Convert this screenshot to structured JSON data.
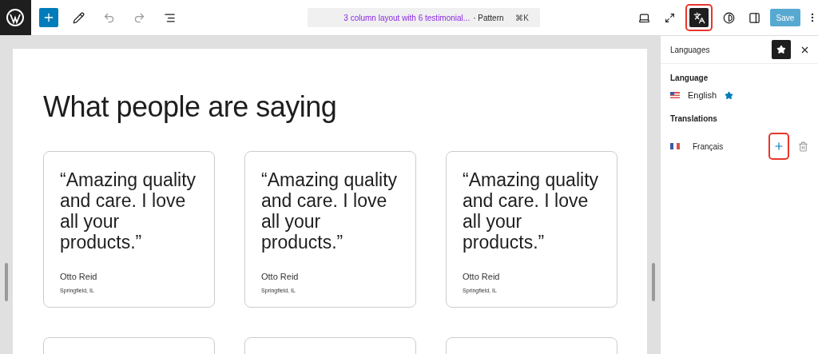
{
  "toolbar": {
    "command_title": "3 column layout with 6 testimonial...",
    "command_kind": "· Pattern",
    "shortcut": "⌘K",
    "translate_highlighted": true,
    "save": {
      "label": "Save",
      "disabled": true
    }
  },
  "page": {
    "heading": "What people are saying",
    "cards": [
      {
        "kind": "full",
        "quote": "“Amazing quality and care. I love all your products.”",
        "name": "Otto Reid",
        "place": "Springfield, IL"
      },
      {
        "kind": "full",
        "quote": "“Amazing quality and care. I love all your products.”",
        "name": "Otto Reid",
        "place": "Springfield, IL"
      },
      {
        "kind": "full",
        "quote": "“Amazing quality and care. I love all your products.”",
        "name": "Otto Reid",
        "place": "Springfield, IL"
      },
      {
        "kind": "cut"
      },
      {
        "kind": "cut"
      },
      {
        "kind": "cut"
      }
    ]
  },
  "sidebar": {
    "title": "Languages",
    "language_heading": "Language",
    "language": {
      "name": "English",
      "default": true
    },
    "translations_heading": "Translations",
    "translations": [
      {
        "name": "Français",
        "add_highlighted": true
      }
    ]
  }
}
